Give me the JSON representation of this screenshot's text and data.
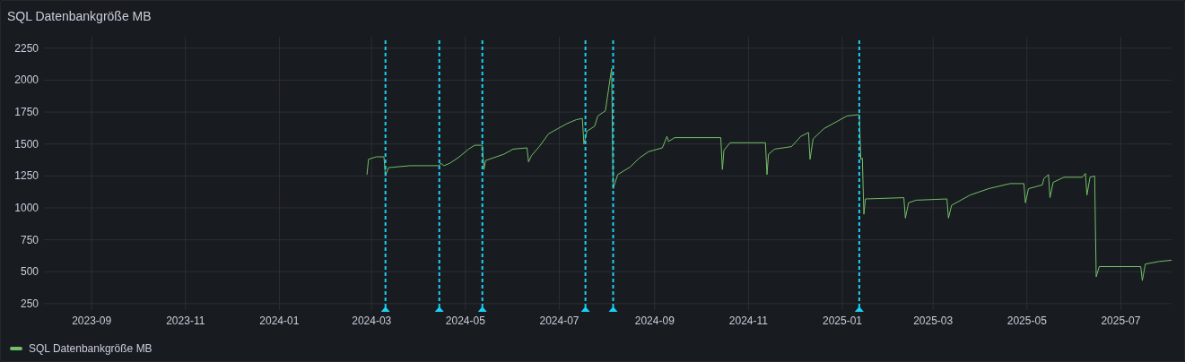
{
  "panel": {
    "title": "SQL Datenbankgröße MB",
    "chart_data": {
      "type": "line",
      "xlim": [
        "2023-08-01",
        "2025-08-03"
      ],
      "ylim": [
        200,
        2340
      ],
      "xticks": [
        "2023-09",
        "2023-11",
        "2024-01",
        "2024-03",
        "2024-05",
        "2024-07",
        "2024-09",
        "2024-11",
        "2025-01",
        "2025-03",
        "2025-05",
        "2025-07"
      ],
      "yticks": [
        250,
        500,
        750,
        1000,
        1250,
        1500,
        1750,
        2000,
        2250
      ],
      "x": [
        "2024-02-27",
        "2024-02-28",
        "2024-03-04",
        "2024-03-09",
        "2024-03-10",
        "2024-03-12",
        "2024-03-26",
        "2024-04-14",
        "2024-04-15",
        "2024-04-17",
        "2024-04-21",
        "2024-04-27",
        "2024-05-03",
        "2024-05-07",
        "2024-05-12",
        "2024-05-13",
        "2024-05-14",
        "2024-05-26",
        "2024-06-01",
        "2024-06-10",
        "2024-06-11",
        "2024-06-13",
        "2024-06-18",
        "2024-06-24",
        "2024-06-30",
        "2024-07-06",
        "2024-07-12",
        "2024-07-16",
        "2024-07-17",
        "2024-07-19",
        "2024-07-24",
        "2024-07-26",
        "2024-07-31",
        "2024-08-04",
        "2024-08-05",
        "2024-08-08",
        "2024-08-16",
        "2024-08-22",
        "2024-08-28",
        "2024-09-06",
        "2024-09-09",
        "2024-09-10",
        "2024-09-14",
        "2024-10-14",
        "2024-10-15",
        "2024-10-16",
        "2024-10-20",
        "2024-11-12",
        "2024-11-13",
        "2024-11-14",
        "2024-11-18",
        "2024-11-29",
        "2024-12-05",
        "2024-12-10",
        "2024-12-11",
        "2024-12-13",
        "2024-12-20",
        "2024-12-29",
        "2025-01-04",
        "2025-01-12",
        "2025-01-13",
        "2025-01-14",
        "2025-01-15",
        "2025-01-16",
        "2025-02-10",
        "2025-02-11",
        "2025-02-13",
        "2025-02-18",
        "2025-03-10",
        "2025-03-11",
        "2025-03-13",
        "2025-03-25",
        "2025-04-06",
        "2025-04-20",
        "2025-04-29",
        "2025-04-30",
        "2025-05-02",
        "2025-05-11",
        "2025-05-12",
        "2025-05-15",
        "2025-05-16",
        "2025-05-18",
        "2025-05-25",
        "2025-06-06",
        "2025-06-08",
        "2025-06-09",
        "2025-06-11",
        "2025-06-14",
        "2025-06-15",
        "2025-06-17",
        "2025-07-14",
        "2025-07-15",
        "2025-07-17",
        "2025-07-26",
        "2025-08-03"
      ],
      "series": [
        {
          "name": "SQL Datenbankgröße MB",
          "color": "#73bf69",
          "values": [
            1260,
            1380,
            1400,
            1400,
            1250,
            1315,
            1330,
            1330,
            1350,
            1330,
            1350,
            1400,
            1460,
            1490,
            1490,
            1300,
            1370,
            1420,
            1460,
            1470,
            1360,
            1410,
            1480,
            1580,
            1620,
            1660,
            1690,
            1700,
            1500,
            1600,
            1640,
            1720,
            1760,
            2090,
            1150,
            1260,
            1320,
            1390,
            1440,
            1470,
            1560,
            1520,
            1550,
            1550,
            1300,
            1450,
            1510,
            1510,
            1260,
            1420,
            1460,
            1480,
            1560,
            1590,
            1380,
            1540,
            1620,
            1680,
            1720,
            1730,
            1380,
            1390,
            950,
            1070,
            1080,
            920,
            1040,
            1060,
            1070,
            920,
            1020,
            1100,
            1150,
            1190,
            1190,
            1040,
            1150,
            1180,
            1230,
            1260,
            1080,
            1200,
            1240,
            1240,
            1270,
            1100,
            1240,
            1250,
            460,
            540,
            540,
            430,
            560,
            580,
            590
          ]
        }
      ],
      "grid": true,
      "ref_lines": [
        {
          "axis": "x",
          "value": "2024-03-10",
          "color": "#1ad0f5"
        },
        {
          "axis": "x",
          "value": "2024-04-14",
          "color": "#1ad0f5"
        },
        {
          "axis": "x",
          "value": "2024-05-12",
          "color": "#1ad0f5"
        },
        {
          "axis": "x",
          "value": "2024-07-18",
          "color": "#1ad0f5"
        },
        {
          "axis": "x",
          "value": "2024-08-05",
          "color": "#1ad0f5"
        },
        {
          "axis": "x",
          "value": "2025-01-12",
          "color": "#1ad0f5"
        }
      ]
    }
  }
}
